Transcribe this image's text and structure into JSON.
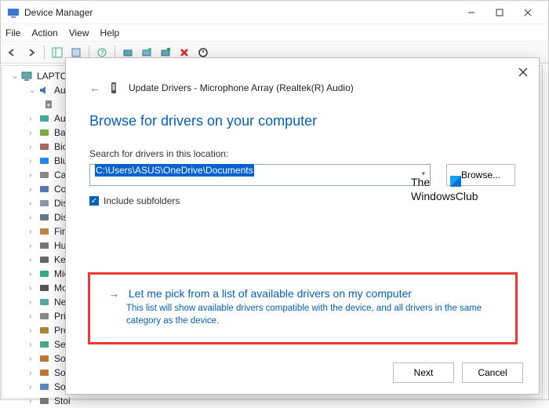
{
  "window": {
    "title": "Device Manager"
  },
  "menu": {
    "file": "File",
    "action": "Action",
    "view": "View",
    "help": "Help"
  },
  "tree": {
    "root": "LAPTOP",
    "current_expanded": "Aud",
    "items": [
      "Auc",
      "Bat",
      "Biol",
      "Blu",
      "Can",
      "Con",
      "Disl",
      "Disp",
      "Firm",
      "Hun",
      "Key",
      "Mic",
      "Mo",
      "Net",
      "Prin",
      "Pro",
      "Sec",
      "Soft",
      "Soft",
      "Sou",
      "Stoi"
    ]
  },
  "dialog": {
    "title": "Update Drivers - Microphone Array (Realtek(R) Audio)",
    "heading": "Browse for drivers on your computer",
    "search_label": "Search for drivers in this location:",
    "path_value": "C:\\Users\\ASUS\\OneDrive\\Documents",
    "browse": "Browse...",
    "include_subfolders": "Include subfolders",
    "pick_title": "Let me pick from a list of available drivers on my computer",
    "pick_desc": "This list will show available drivers compatible with the device, and all drivers in the same category as the device.",
    "next": "Next",
    "cancel": "Cancel"
  },
  "watermark": {
    "line1": "The",
    "line2": "WindowsClub"
  }
}
